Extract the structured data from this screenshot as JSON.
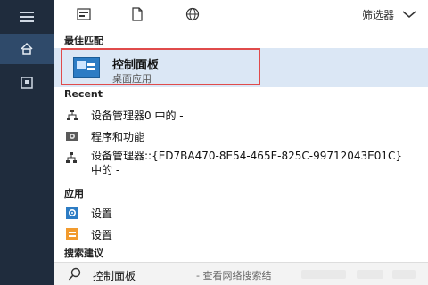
{
  "topbar": {
    "filter_label": "筛选器"
  },
  "sections": {
    "best_match": "最佳匹配",
    "recent": "Recent",
    "apps": "应用",
    "suggest": "搜索建议"
  },
  "best_match": {
    "title": "控制面板",
    "subtitle": "桌面应用"
  },
  "recent_items": [
    {
      "text": "设备管理器0 中的 -"
    },
    {
      "text": "程序和功能"
    },
    {
      "text": "设备管理器::{ED7BA470-8E54-465E-825C-99712043E01C} 中的 -"
    }
  ],
  "app_items": [
    {
      "text": "设置"
    },
    {
      "text": "设置"
    }
  ],
  "suggestion": {
    "query": "控制面板",
    "hint": "- 查看网络搜索结"
  }
}
